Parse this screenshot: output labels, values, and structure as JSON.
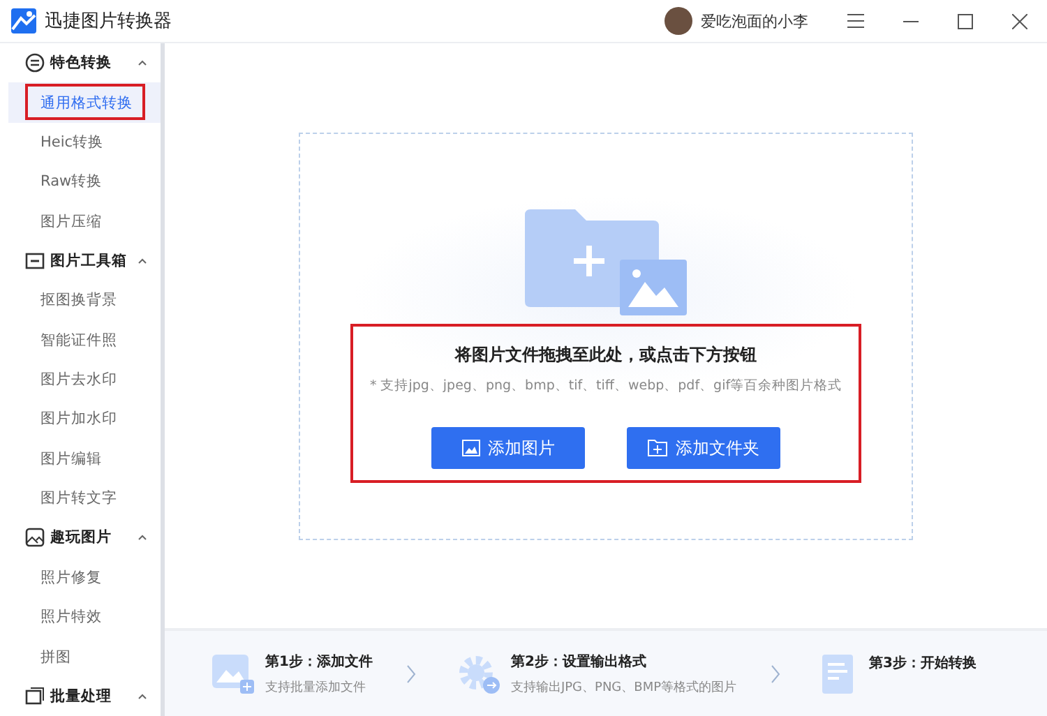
{
  "window": {
    "title": "迅捷图片转换器"
  },
  "user": {
    "name": "爱吃泡面的小李"
  },
  "sidebar": {
    "groups": [
      {
        "title": "特色转换",
        "expanded": true,
        "items": [
          {
            "label": "通用格式转换",
            "selected": true,
            "highlighted": true
          },
          {
            "label": "Heic转换",
            "selected": false,
            "highlighted": false
          },
          {
            "label": "Raw转换",
            "selected": false,
            "highlighted": false
          },
          {
            "label": "图片压缩",
            "selected": false,
            "highlighted": false
          }
        ]
      },
      {
        "title": "图片工具箱",
        "expanded": true,
        "items": [
          {
            "label": "抠图换背景",
            "selected": false,
            "highlighted": false
          },
          {
            "label": "智能证件照",
            "selected": false,
            "highlighted": false
          },
          {
            "label": "图片去水印",
            "selected": false,
            "highlighted": false
          },
          {
            "label": "图片加水印",
            "selected": false,
            "highlighted": false
          },
          {
            "label": "图片编辑",
            "selected": false,
            "highlighted": false
          },
          {
            "label": "图片转文字",
            "selected": false,
            "highlighted": false
          }
        ]
      },
      {
        "title": "趣玩图片",
        "expanded": true,
        "items": [
          {
            "label": "照片修复",
            "selected": false,
            "highlighted": false
          },
          {
            "label": "照片特效",
            "selected": false,
            "highlighted": false
          },
          {
            "label": "拼图",
            "selected": false,
            "highlighted": false
          }
        ]
      },
      {
        "title": "批量处理",
        "expanded": true
      }
    ]
  },
  "drop_zone": {
    "title": "将图片文件拖拽至此处，或点击下方按钮",
    "hint": "* 支持jpg、jpeg、png、bmp、tif、tiff、webp、pdf、gif等百余种图片格式",
    "highlighted": true,
    "buttons": [
      {
        "label": "添加图片"
      },
      {
        "label": "添加文件夹"
      }
    ]
  },
  "steps": [
    {
      "title": "第1步：添加文件",
      "subtitle": "支持批量添加文件"
    },
    {
      "title": "第2步：设置输出格式",
      "subtitle": "支持输出JPG、PNG、BMP等格式的图片"
    },
    {
      "title": "第3步：开始转换"
    }
  ]
}
